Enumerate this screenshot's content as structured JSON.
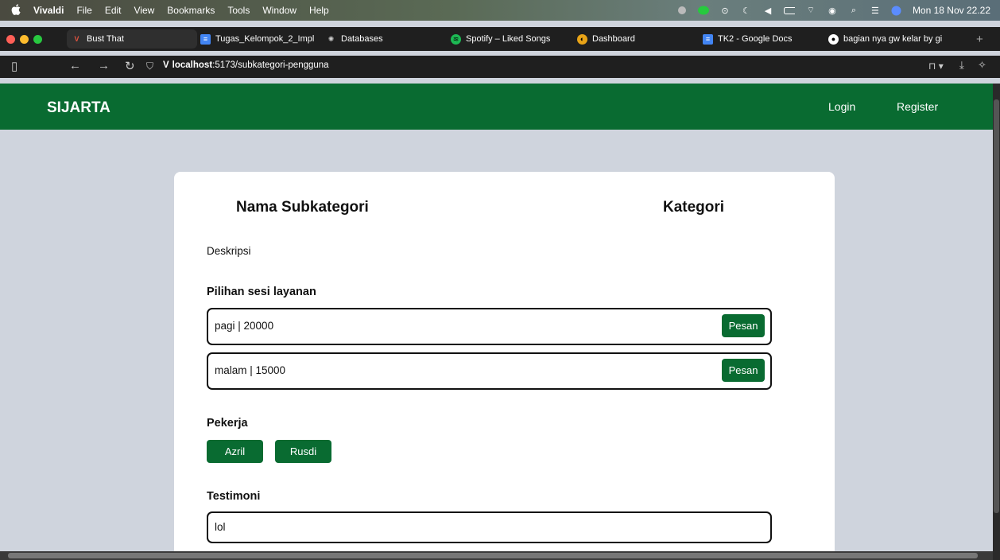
{
  "menubar": {
    "apple": "",
    "app_name": "Vivaldi",
    "menus": [
      "File",
      "Edit",
      "View",
      "Bookmarks",
      "Tools",
      "Window",
      "Help"
    ],
    "clock": "Mon 18 Nov 22.22"
  },
  "tabs": [
    {
      "label": "Bust That",
      "icon": "vivaldi-icon",
      "color": "#e2533f"
    },
    {
      "label": "Tugas_Kelompok_2_Impl",
      "icon": "docs-icon",
      "color": "#4285f4"
    },
    {
      "label": "Databases",
      "icon": "openai-icon",
      "color": "#888888"
    },
    {
      "label": "Spotify – Liked Songs",
      "icon": "spotify-icon",
      "color": "#1db954"
    },
    {
      "label": "Dashboard",
      "icon": "dashboard-icon",
      "color": "#e8a317"
    },
    {
      "label": "TK2 - Google Docs",
      "icon": "docs-icon",
      "color": "#4285f4"
    },
    {
      "label": "bagian nya gw kelar by gi",
      "icon": "github-icon",
      "color": "#ffffff"
    }
  ],
  "new_tab": "+",
  "address": {
    "host": "localhost",
    "path": ":5173/subkategori-pengguna"
  },
  "nav": {
    "brand": "SIJARTA",
    "login": "Login",
    "register": "Register"
  },
  "content": {
    "subkategori_title": "Nama Subkategori",
    "kategori_title": "Kategori",
    "deskripsi": "Deskripsi",
    "sessions_heading": "Pilihan sesi layanan",
    "sessions": [
      {
        "text": "pagi | 20000",
        "button": "Pesan"
      },
      {
        "text": "malam | 15000",
        "button": "Pesan"
      }
    ],
    "workers_heading": "Pekerja",
    "workers": [
      "Azril",
      "Rusdi"
    ],
    "testimoni_heading": "Testimoni",
    "testimoni_value": "lol"
  },
  "colors": {
    "brand_green": "#096b31",
    "page_bg": "#cfd4dd"
  }
}
